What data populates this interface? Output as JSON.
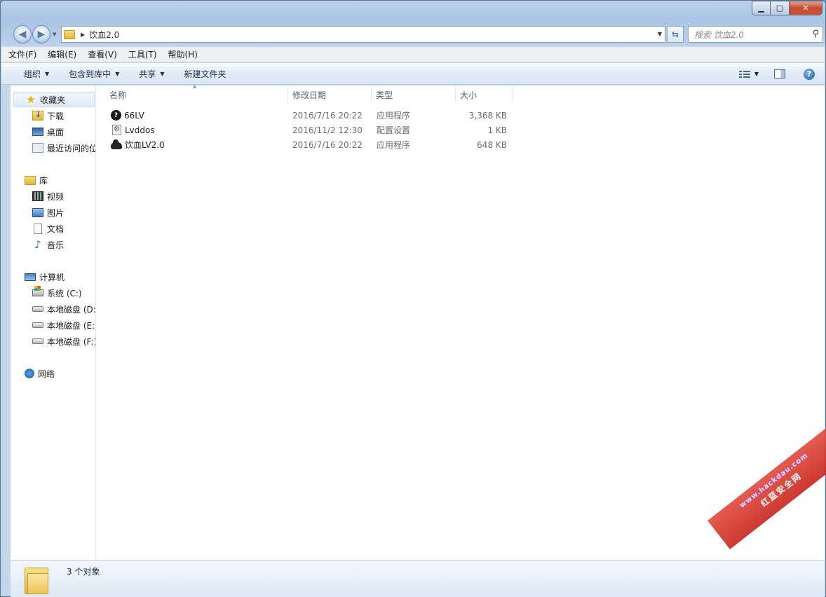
{
  "window": {
    "title": "",
    "controls": {
      "minimize": "▁",
      "maximize": "□",
      "close": "✕"
    }
  },
  "address_bar": {
    "path": "饮血2.0",
    "search_placeholder": "搜索 饮血2.0"
  },
  "menu": {
    "items": [
      "文件(F)",
      "编辑(E)",
      "查看(V)",
      "工具(T)",
      "帮助(H)"
    ]
  },
  "toolbar": {
    "organize": "组织",
    "include_library": "包含到库中",
    "share": "共享",
    "new_folder": "新建文件夹",
    "help": "?"
  },
  "sidebar": {
    "favorites": {
      "label": "收藏夹",
      "items": [
        "下载",
        "桌面",
        "最近访问的位置"
      ]
    },
    "libraries": {
      "label": "库",
      "items": [
        "视频",
        "图片",
        "文档",
        "音乐"
      ]
    },
    "computer": {
      "label": "计算机",
      "items": [
        "系统 (C:)",
        "本地磁盘 (D:)",
        "本地磁盘 (E:)",
        "本地磁盘 (F:)"
      ]
    },
    "network": {
      "label": "网络"
    }
  },
  "columns": {
    "name": "名称",
    "date": "修改日期",
    "type": "类型",
    "size": "大小"
  },
  "files": [
    {
      "name": "66LV",
      "date": "2016/7/16 20:22",
      "type": "应用程序",
      "size": "3,368 KB",
      "icon": "app-icon"
    },
    {
      "name": "Lvddos",
      "date": "2016/11/2 12:30",
      "type": "配置设置",
      "size": "1 KB",
      "icon": "config-file-icon"
    },
    {
      "name": "饮血LV2.0",
      "date": "2016/7/16 20:22",
      "type": "应用程序",
      "size": "648 KB",
      "icon": "cloud-app-icon"
    }
  ],
  "status": {
    "count_text": "3 个对象"
  },
  "watermark": {
    "line1": "www.hackdau.com",
    "line2": "红蓝安全网"
  }
}
